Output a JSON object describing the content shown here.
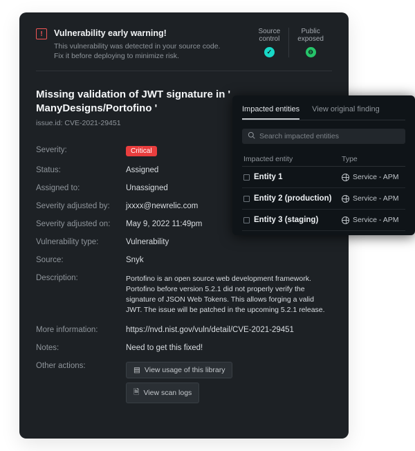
{
  "banner": {
    "title": "Vulnerability early warning!",
    "sub": "This vulnerability was detected in your source code. Fix it before deploying to minimize risk.",
    "status": {
      "source_control": {
        "label": "Source\ncontrol"
      },
      "public_exposed": {
        "label": "Public\nexposed"
      }
    }
  },
  "heading": {
    "title": "Missing validation of JWT signature in ' ManyDesigns/Portofino '",
    "issue_id": "issue.id: CVE-2021-29451"
  },
  "details": {
    "severity_label": "Severity:",
    "severity_value": "Critical",
    "status_label": "Status:",
    "status_value": "Assigned",
    "assigned_label": "Assigned to:",
    "assigned_value": "Unassigned",
    "sev_adj_by_label": "Severity adjusted by:",
    "sev_adj_by_value": "jxxxx@newrelic.com",
    "sev_adj_on_label": "Severity adjusted on:",
    "sev_adj_on_value": "May 9, 2022 11:49pm",
    "vuln_type_label": "Vulnerability type:",
    "vuln_type_value": "Vulnerability",
    "source_label": "Source:",
    "source_value": "Snyk",
    "desc_label": "Description:",
    "desc_value": "Portofino is an open source web development framework. Portofino before version 5.2.1 did not properly verify the signature of JSON Web Tokens. This allows forging a valid JWT. The issue will be patched in the upcoming 5.2.1 release.",
    "more_info_label": "More information:",
    "more_info_value": "https://nvd.nist.gov/vuln/detail/CVE-2021-29451",
    "notes_label": "Notes:",
    "notes_value": "Need to get this fixed!",
    "other_actions_label": "Other actions:",
    "action_usage": "View usage of this library",
    "action_logs": "View scan logs"
  },
  "side": {
    "tabs": {
      "impacted": "Impacted entities",
      "original": "View original finding"
    },
    "search_placeholder": "Search impacted entities",
    "columns": {
      "entity": "Impacted entity",
      "type": "Type"
    },
    "type_label": "Service - APM",
    "entities": [
      {
        "name": "Entity 1"
      },
      {
        "name": "Entity 2 (production)"
      },
      {
        "name": "Entity 3 (staging)"
      }
    ]
  }
}
